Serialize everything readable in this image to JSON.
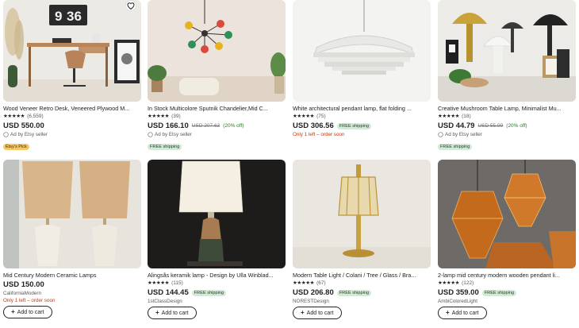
{
  "products": [
    {
      "title": "Wood Veneer Retro Desk, Veneered Plywood M...",
      "stars": "★★★★★",
      "reviews": "(6,559)",
      "price": "USD 550.00",
      "ad": "Ad by Etsy seller",
      "badge": "Etsy's Pick"
    },
    {
      "title": "In Stock Multicolore Sputnik Chandelier,Mid C...",
      "stars": "★★★★★",
      "reviews": "(39)",
      "price": "USD 166.10",
      "original_price": "USD 207.63",
      "discount": "(20% off)",
      "ad": "Ad by Etsy seller",
      "shipping": "FREE shipping"
    },
    {
      "title": "White architectural pendant lamp, flat folding ...",
      "stars": "★★★★★",
      "reviews": "(75)",
      "price": "USD 306.56",
      "shipping": "FREE shipping",
      "stock_note": "Only 1 left – order soon"
    },
    {
      "title": "Creative Mushroom Table Lamp, Minimalist Mu...",
      "stars": "★★★★★",
      "reviews": "(18)",
      "price": "USD 44.79",
      "original_price": "USD 55.99",
      "discount": "(20% off)",
      "ad": "Ad by Etsy seller",
      "shipping": "FREE shipping"
    },
    {
      "title": "Mid Century Modern Ceramic Lamps",
      "price": "USD 150.00",
      "shop": "CaliforniaModern",
      "stock_note": "Only 1 left – order soon",
      "cart_label": "Add to cart"
    },
    {
      "title": "Alingsås keramik lamp - Design by Ulla Winblad...",
      "stars": "★★★★★",
      "reviews": "(115)",
      "price": "USD 144.45",
      "shipping": "FREE shipping",
      "shop": "1stClassDesign",
      "cart_label": "Add to cart"
    },
    {
      "title": "Modern Table Light / Colani / Tree / Glass / Bra...",
      "stars": "★★★★★",
      "reviews": "(67)",
      "price": "USD 206.80",
      "shipping": "FREE shipping",
      "shop": "NORESTDesign",
      "cart_label": "Add to cart"
    },
    {
      "title": "2-lamp mid century modern wooden pendant li...",
      "stars": "★★★★★",
      "reviews": "(122)",
      "price": "USD 359.00",
      "shipping": "FREE shipping",
      "shop": "AmbiColoredLight",
      "cart_label": "Add to cart"
    }
  ],
  "clock": {
    "hours": "9",
    "minutes": "36"
  },
  "colors": {
    "free_shipping_bg": "#d4e9d7",
    "etsy_pick_bg": "#f5c96a",
    "urgent_text": "#c23a0e",
    "discount_text": "#2a7a2a"
  }
}
